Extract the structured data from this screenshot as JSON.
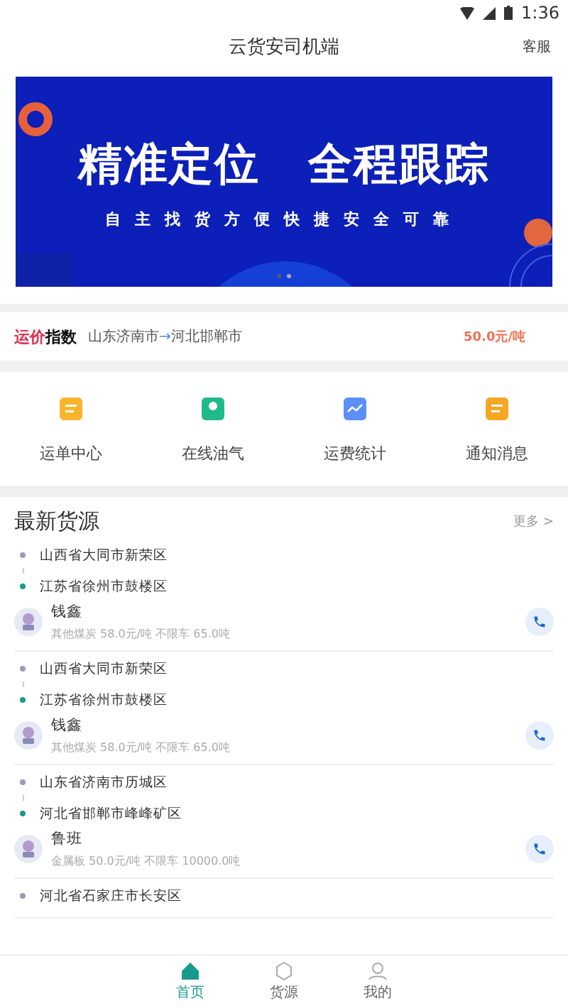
{
  "status_bar": {
    "time": "1:36"
  },
  "header": {
    "title": "云货安司机端",
    "action": "客服"
  },
  "banner": {
    "headline_left": "精准定位",
    "headline_right": "全程跟踪",
    "tagline": "自主找货方便快捷安全可靠",
    "dots": [
      {
        "selected": false
      },
      {
        "selected": true
      }
    ]
  },
  "price_index": {
    "label_accent": "运价",
    "label": "指数",
    "route_from": "山东济南市",
    "arrow": "→",
    "route_to": "河北邯郸市",
    "price": "50.0元/吨"
  },
  "shortcuts": [
    {
      "label": "运单中心",
      "color": "#f7b52c"
    },
    {
      "label": "在线油气",
      "color": "#1fb98a"
    },
    {
      "label": "运费统计",
      "color": "#5b8ff9"
    },
    {
      "label": "通知消息",
      "color": "#f5a623"
    }
  ],
  "section": {
    "title": "最新货源",
    "more": "更多",
    "more_icon": ">"
  },
  "cargo": [
    {
      "from": "山西省大同市新荣区",
      "to": "江苏省徐州市鼓楼区",
      "name": "钱鑫",
      "detail": "其他煤炭 58.0元/吨 不限车 65.0吨"
    },
    {
      "from": "山西省大同市新荣区",
      "to": "江苏省徐州市鼓楼区",
      "name": "钱鑫",
      "detail": "其他煤炭 58.0元/吨 不限车 65.0吨"
    },
    {
      "from": "山东省济南市历城区",
      "to": "河北省邯郸市峰峰矿区",
      "name": "鲁班",
      "detail": "金属板 50.0元/吨 不限车 10000.0吨"
    },
    {
      "from": "河北省石家庄市长安区"
    }
  ],
  "tabs": [
    {
      "label": "首页",
      "selected": true
    },
    {
      "label": "货源",
      "selected": false
    },
    {
      "label": "我的",
      "selected": false
    }
  ]
}
